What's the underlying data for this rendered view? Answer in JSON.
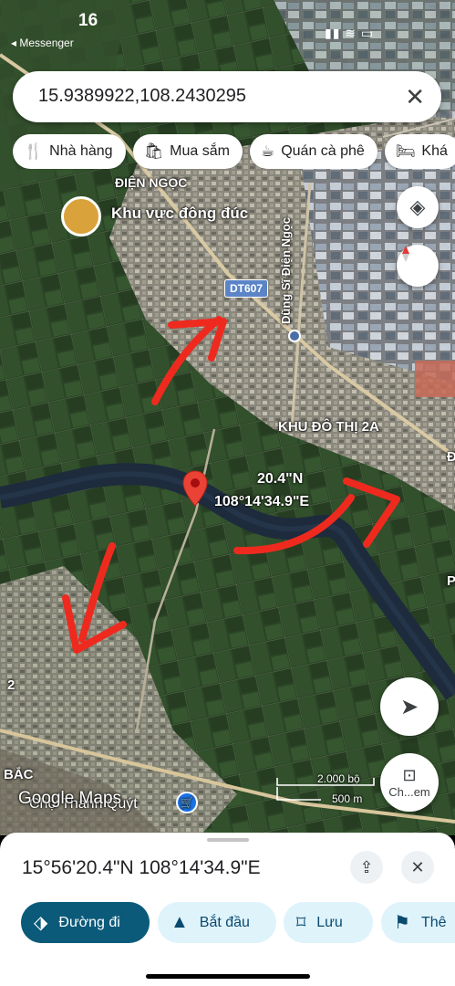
{
  "status_bar": {
    "time": "16",
    "back_app": "◂ Messenger"
  },
  "search": {
    "query": "15.9389922,108.2430295"
  },
  "chips": [
    {
      "icon": "restaurant-icon",
      "label": "Nhà hàng"
    },
    {
      "icon": "shopping-icon",
      "label": "Mua sắm"
    },
    {
      "icon": "cafe-icon",
      "label": "Quán cà phê"
    },
    {
      "icon": "hotel-icon",
      "label": "Khá"
    }
  ],
  "map": {
    "labels": {
      "dien_ngoc": "ĐIỆN NGỌC",
      "busy_area": "Khu vực đông đúc",
      "road_dt607": "DT607",
      "street": "Dũng Sĩ Điện Ngọc",
      "khu_do_thi": "KHU ĐÔ THỊ 2A",
      "pin_lat_partial": "20.4\"N",
      "pin_lng": "108°14'34.9\"E",
      "left_2": "2",
      "bac": "BẮC",
      "cho": "Chợ Thanh Quýt",
      "right_p": "P",
      "right_d": "Đ"
    },
    "scale": {
      "imperial": "2.000 bộ",
      "metric": "500 m"
    },
    "watermark": "Google Maps",
    "street_view_label": "Ch...em",
    "colors": {
      "arrow": "#ee2a1f",
      "pin": "#ea4335",
      "river": "#1d2b3d"
    }
  },
  "sheet": {
    "coordinates": "15°56'20.4\"N 108°14'34.9\"E",
    "actions": [
      {
        "icon": "directions-icon",
        "label": "Đường đi"
      },
      {
        "icon": "navigation-icon",
        "label": "Bắt đầu"
      },
      {
        "icon": "bookmark-icon",
        "label": "Lưu"
      },
      {
        "icon": "flag-icon",
        "label": "Thê"
      }
    ]
  }
}
